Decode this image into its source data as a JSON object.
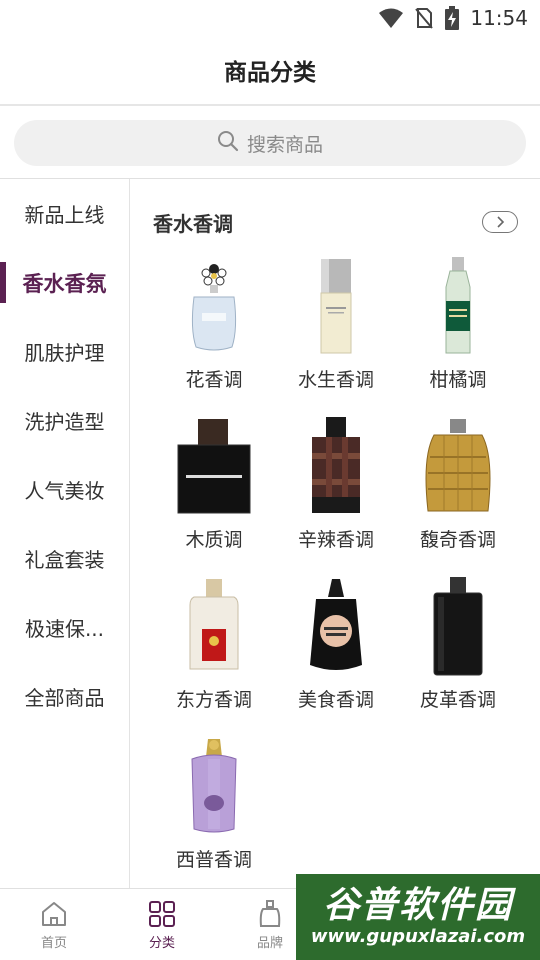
{
  "status_bar": {
    "time": "11:54",
    "icons": [
      "wifi-icon",
      "no-sim-icon",
      "battery-charging-icon"
    ]
  },
  "header": {
    "title": "商品分类"
  },
  "search": {
    "placeholder": "搜索商品",
    "icon": "search-icon"
  },
  "sidebar": {
    "items": [
      {
        "label": "新品上线"
      },
      {
        "label": "香水香氛",
        "active": true
      },
      {
        "label": "肌肤护理"
      },
      {
        "label": "洗护造型"
      },
      {
        "label": "人气美妆"
      },
      {
        "label": "礼盒套装"
      },
      {
        "label": "极速保..."
      },
      {
        "label": "全部商品"
      }
    ]
  },
  "section": {
    "title": "香水香调",
    "more_icon": "chevron-right-icon",
    "items": [
      {
        "label": "花香调",
        "image": "daisy-perfume-bottle"
      },
      {
        "label": "水生香调",
        "image": "leau-dissey-bottle"
      },
      {
        "label": "柑橘调",
        "image": "acqua-colonia-bottle"
      },
      {
        "label": "木质调",
        "image": "encre-noire-bottle"
      },
      {
        "label": "辛辣香调",
        "image": "burberry-london-bottle"
      },
      {
        "label": "馥奇香调",
        "image": "wicker-john-varvatos-bottle"
      },
      {
        "label": "东方香调",
        "image": "shalimar-red-bottle"
      },
      {
        "label": "美食香调",
        "image": "black-opium-bottle"
      },
      {
        "label": "皮革香调",
        "image": "brit-black-bottle"
      },
      {
        "label": "西普香调",
        "image": "purple-ornate-bottle"
      }
    ]
  },
  "tabbar": {
    "tabs": [
      {
        "label": "首页",
        "icon": "home-icon"
      },
      {
        "label": "分类",
        "icon": "category-grid-icon",
        "active": true
      },
      {
        "label": "品牌",
        "icon": "perfume-bottle-icon"
      }
    ]
  },
  "watermark": {
    "cn": "谷普软件园",
    "en": "www.gupuxlazai.com"
  },
  "colors": {
    "accent": "#5b2152",
    "search_bg": "#f0f0f0",
    "divider": "#e0e0e0"
  }
}
